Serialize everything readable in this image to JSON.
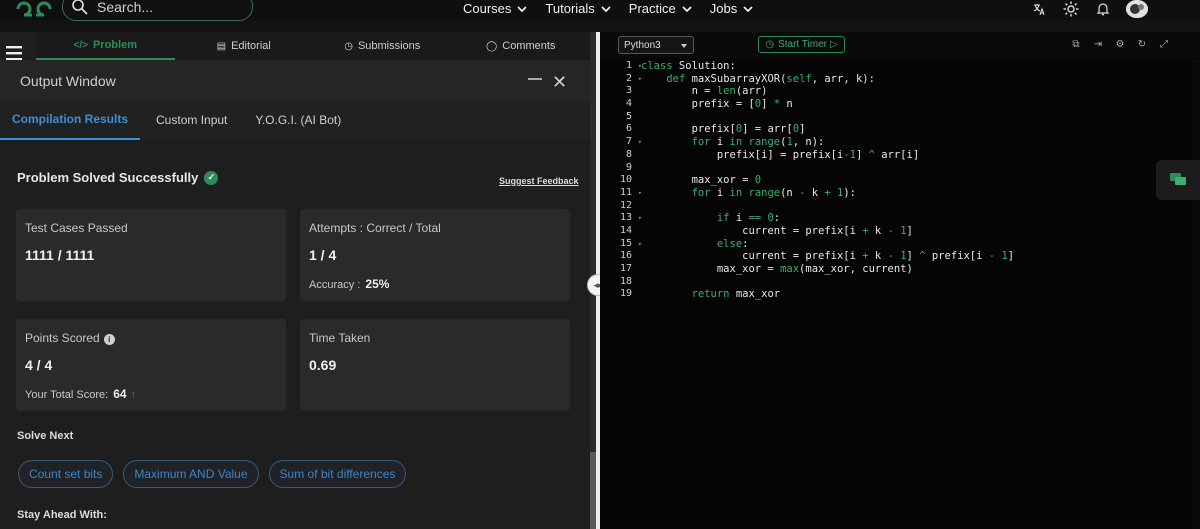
{
  "nav": {
    "search_placeholder": "Search...",
    "links": [
      "Courses",
      "Tutorials",
      "Practice",
      "Jobs"
    ]
  },
  "problem_tabs": [
    "Problem",
    "Editorial",
    "Submissions",
    "Comments"
  ],
  "output_window": {
    "title": "Output Window",
    "tabs": [
      "Compilation Results",
      "Custom Input",
      "Y.O.G.I. (AI Bot)"
    ]
  },
  "result": {
    "status": "Problem Solved Successfully",
    "feedback_link": "Suggest Feedback",
    "test_cases": {
      "label": "Test Cases Passed",
      "value": "1111 / 1111"
    },
    "attempts": {
      "label": "Attempts : Correct / Total",
      "value": "1 / 4",
      "accuracy_label": "Accuracy :",
      "accuracy_value": "25%"
    },
    "points": {
      "label": "Points Scored",
      "value": "4 / 4",
      "total_label": "Your Total Score:",
      "total_value": "64"
    },
    "time": {
      "label": "Time Taken",
      "value": "0.69"
    }
  },
  "solve_next": {
    "heading": "Solve Next",
    "items": [
      "Count set bits",
      "Maximum AND Value",
      "Sum of bit differences"
    ]
  },
  "stay_ahead": "Stay Ahead With:",
  "editor": {
    "language": "Python3",
    "timer_label": "Start Timer",
    "line_numbers": [
      "1",
      "2",
      "3",
      "4",
      "5",
      "6",
      "7",
      "8",
      "9",
      "10",
      "11",
      "12",
      "13",
      "14",
      "15",
      "16",
      "17",
      "18",
      "19"
    ],
    "folded_lines": [
      1,
      2,
      7,
      11,
      13,
      15
    ],
    "code": [
      "class Solution:",
      "    def maxSubarrayXOR(self, arr, k):",
      "        n = len(arr)",
      "        prefix = [0] * n",
      "",
      "        prefix[0] = arr[0]",
      "        for i in range(1, n):",
      "            prefix[i] = prefix[i-1] ^ arr[i]",
      "",
      "        max_xor = 0",
      "        for i in range(n - k + 1):",
      "",
      "            if i == 0:",
      "                current = prefix[i + k - 1]",
      "            else:",
      "                current = prefix[i + k - 1] ^ prefix[i - 1]",
      "            max_xor = max(max_xor, current)",
      "",
      "        return max_xor"
    ]
  },
  "colors": {
    "accent_green": "#2e8b57",
    "accent_blue": "#3b8fd9",
    "panel_bg": "#1e1e1e",
    "editor_bg": "#050505"
  }
}
